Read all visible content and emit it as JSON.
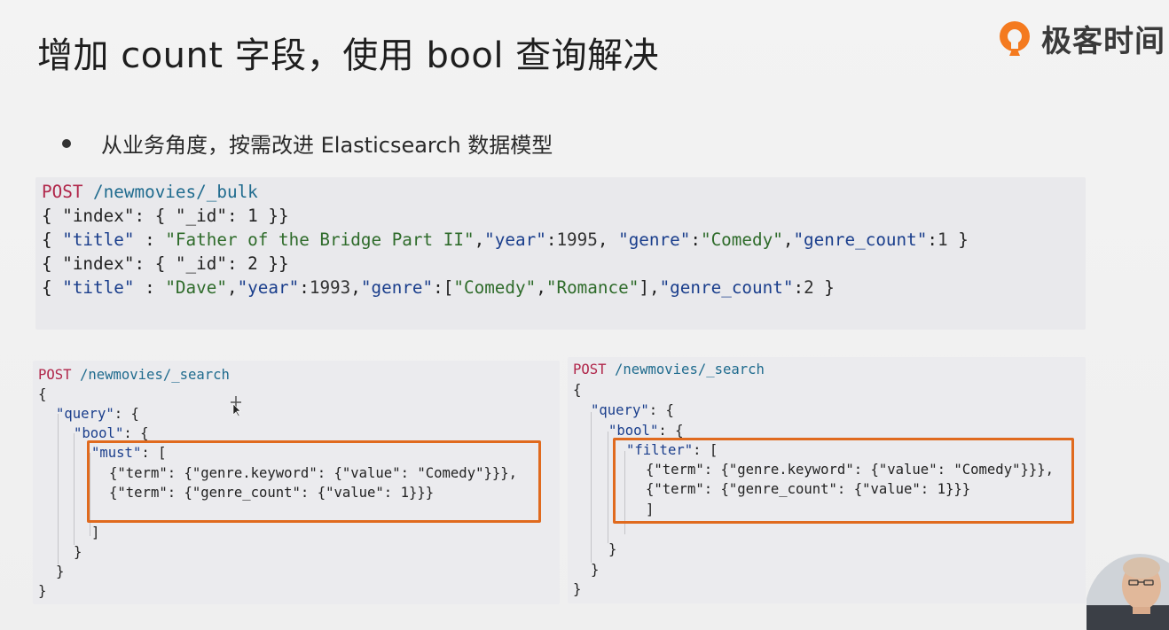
{
  "slide": {
    "title": "增加 count 字段，使用 bool 查询解决",
    "logo_text": "极客时间",
    "bullet": "从业务角度，按需改进 Elasticsearch 数据模型"
  },
  "bulk_request": {
    "method": "POST",
    "path": "/newmovies/_bulk",
    "line1": "{ \"index\": { \"_id\": 1 }}",
    "line2_key_title": "\"title\"",
    "line2_title_val": "\"Father of the Bridge Part II\"",
    "line2_key_year": "\"year\"",
    "line2_year_val": "1995",
    "line2_key_genre": "\"genre\"",
    "line2_genre_val": "\"Comedy\"",
    "line2_key_count": "\"genre_count\"",
    "line2_count_val": "1",
    "line3": "{ \"index\": { \"_id\": 2 }}",
    "line4_key_title": "\"title\"",
    "line4_title_val": "\"Dave\"",
    "line4_key_year": "\"year\"",
    "line4_year_val": "1993",
    "line4_key_genre": "\"genre\"",
    "line4_genre_val1": "\"Comedy\"",
    "line4_genre_val2": "\"Romance\"",
    "line4_key_count": "\"genre_count\"",
    "line4_count_val": "2"
  },
  "search_must": {
    "method": "POST",
    "path": "/newmovies/_search",
    "open": "{",
    "query_key": "\"query\"",
    "bool_key": "\"bool\"",
    "clause_key": "\"must\"",
    "term1": "{\"term\": {\"genre.keyword\": {\"value\": \"Comedy\"}}},",
    "term2": "{\"term\": {\"genre_count\": {\"value\": 1}}}",
    "close_bracket": "]",
    "close_bool": "}",
    "close_query": "}",
    "close": "}"
  },
  "search_filter": {
    "method": "POST",
    "path": "/newmovies/_search",
    "open": "{",
    "query_key": "\"query\"",
    "bool_key": "\"bool\"",
    "clause_key": "\"filter\"",
    "term1": "{\"term\": {\"genre.keyword\": {\"value\": \"Comedy\"}}},",
    "term2": "{\"term\": {\"genre_count\": {\"value\": 1}}}",
    "close_bracket": "]",
    "close_bool": "}",
    "close_query": "}",
    "close": "}"
  },
  "colors": {
    "highlight_box": "#e06a1e",
    "logo_orange": "#f47a1f",
    "method": "#b0264a"
  }
}
